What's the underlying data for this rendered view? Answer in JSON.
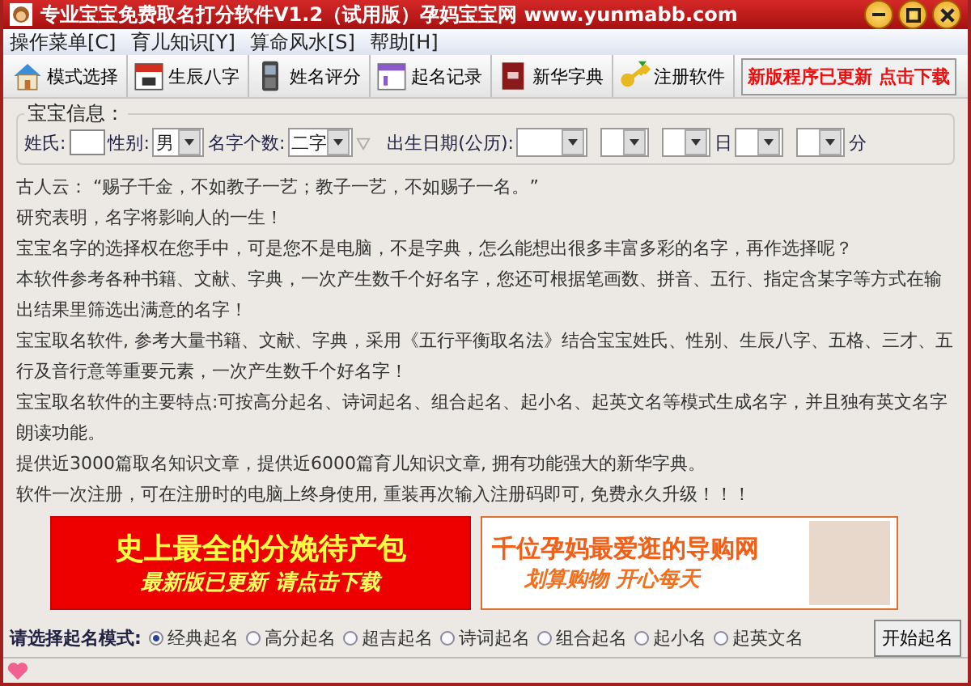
{
  "window": {
    "title": "专业宝宝免费取名打分软件V1.2（试用版）孕妈宝宝网 www.yunmabb.com"
  },
  "menu": [
    "操作菜单[C]",
    "育儿知识[Y]",
    "算命风水[S]",
    "帮助[H]"
  ],
  "toolbar": [
    {
      "label": "模式选择",
      "kind": "house"
    },
    {
      "label": "生辰八字",
      "kind": "calendar"
    },
    {
      "label": "姓名评分",
      "kind": "phone"
    },
    {
      "label": "起名记录",
      "kind": "note"
    },
    {
      "label": "新华字典",
      "kind": "book"
    },
    {
      "label": "注册软件",
      "kind": "key"
    }
  ],
  "update_notice": "新版程序已更新 点击下载",
  "baby_info": {
    "title": "宝宝信息：",
    "surname_label": "姓氏:",
    "gender_label": "性别:",
    "gender": "男",
    "name_length_label": "名字个数:",
    "name_length": "二字",
    "birth_label": "出生日期(公历):",
    "day_label": "日",
    "minute_label": "分"
  },
  "paragraphs": [
    "古人云： “赐子千金，不如教子一艺；教子一艺，不如赐子一名。”",
    "研究表明，名字将影响人的一生！",
    "宝宝名字的选择权在您手中，可是您不是电脑，不是字典，怎么能想出很多丰富多彩的名字，再作选择呢？",
    "本软件参考各种书籍、文献、字典，一次产生数千个好名字，您还可根据笔画数、拼音、五行、指定含某字等方式在输出结果里筛选出满意的名字！",
    "宝宝取名软件, 参考大量书籍、文献、字典，采用《五行平衡取名法》结合宝宝姓氏、性别、生辰八字、五格、三才、五行及音行意等重要元素，一次产生数千个好名字！",
    "宝宝取名软件的主要特点:可按高分起名、诗词起名、组合起名、起小名、起英文名等模式生成名字，并且独有英文名字朗读功能。",
    "提供近3000篇取名知识文章，提供近6000篇育儿知识文章, 拥有功能强大的新华字典。",
    "软件一次注册，可在注册时的电脑上终身使用, 重装再次输入注册码即可, 免费永久升级！！！"
  ],
  "banners": [
    {
      "headline": "史上最全的分娩待产包",
      "subline": "最新版已更新 请点击下载"
    },
    {
      "headline": "千位孕妈最爱逛的导购网",
      "subline": "划算购物 开心每天"
    }
  ],
  "mode": {
    "label": "请选择起名模式:",
    "options": [
      {
        "label": "经典起名",
        "selected": true
      },
      {
        "label": "高分起名",
        "selected": false
      },
      {
        "label": "超吉起名",
        "selected": false
      },
      {
        "label": "诗词起名",
        "selected": false
      },
      {
        "label": "组合起名",
        "selected": false
      },
      {
        "label": "起小名",
        "selected": false
      },
      {
        "label": "起英文名",
        "selected": false
      }
    ],
    "button": "开始起名"
  }
}
